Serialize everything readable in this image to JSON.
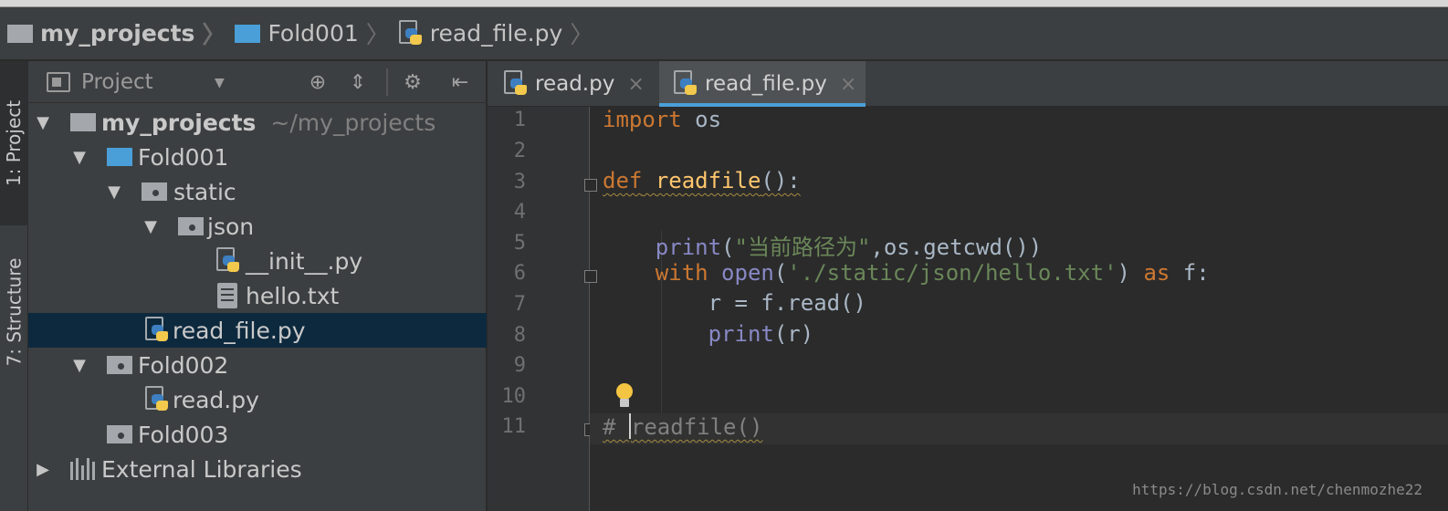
{
  "breadcrumbs": [
    {
      "label": "my_projects",
      "icon": "folder-icon"
    },
    {
      "label": "Fold001",
      "icon": "folder-blue-icon"
    },
    {
      "label": "read_file.py",
      "icon": "python-file-icon"
    }
  ],
  "tool_strip": {
    "project_tab": "1: Project",
    "structure_tab": "7: Structure"
  },
  "project_panel": {
    "title": "Project",
    "dropdown_icon": "triangle-down-icon",
    "header_buttons": [
      "locate-icon",
      "collapse-all-icon",
      "gear-icon",
      "hide-panel-icon"
    ],
    "tree": [
      {
        "label": "my_projects",
        "hint": "~/my_projects",
        "icon": "folder-icon",
        "expanded": true
      },
      {
        "label": "Fold001",
        "icon": "folder-blue-icon",
        "expanded": true
      },
      {
        "label": "static",
        "icon": "resource-folder-icon",
        "expanded": true
      },
      {
        "label": "json",
        "icon": "resource-folder-icon",
        "expanded": true
      },
      {
        "label": "__init__.py",
        "icon": "python-file-icon"
      },
      {
        "label": "hello.txt",
        "icon": "text-file-icon"
      },
      {
        "label": "read_file.py",
        "icon": "python-file-icon",
        "selected": true
      },
      {
        "label": "Fold002",
        "icon": "resource-folder-icon",
        "expanded": true
      },
      {
        "label": "read.py",
        "icon": "python-file-icon"
      },
      {
        "label": "Fold003",
        "icon": "resource-folder-icon"
      },
      {
        "label": "External Libraries",
        "icon": "libraries-icon",
        "expanded": false
      }
    ]
  },
  "editor_tabs": [
    {
      "label": "read.py",
      "close": "×",
      "active": false
    },
    {
      "label": "read_file.py",
      "close": "×",
      "active": true
    }
  ],
  "editor": {
    "line_numbers": [
      "1",
      "2",
      "3",
      "4",
      "5",
      "6",
      "7",
      "8",
      "9",
      "10",
      "11"
    ],
    "current_line": "11",
    "code": {
      "l1_import": "import",
      "l1_rest": " os",
      "l3_def": "def",
      "l3_name": "readfile",
      "l3_rest": "():",
      "l5_indent": "    ",
      "l5_print": "print",
      "l5_open": "(",
      "l5_str": "\"当前路径为\"",
      "l5_rest": ",os.getcwd())",
      "l6_indent": "    ",
      "l6_with": "with",
      "l6_sp": " ",
      "l6_open": "open",
      "l6_paren": "(",
      "l6_str": "'./static/json/hello.txt'",
      "l6_close": ") ",
      "l6_as": "as",
      "l6_rest": " f:",
      "l7": "        r = f.read()",
      "l8_indent": "        ",
      "l8_print": "print",
      "l8_rest": "(r)",
      "l11_hash": "# ",
      "l11_rest": "readfile()"
    }
  },
  "watermark": "https://blog.csdn.net/chenmozhe22",
  "colors": {
    "keyword": "#cc7832",
    "function": "#ffc66d",
    "builtin": "#8888c6",
    "string": "#6a8759",
    "comment": "#808080",
    "selection": "#0d293e",
    "accent": "#4a9fd8"
  }
}
